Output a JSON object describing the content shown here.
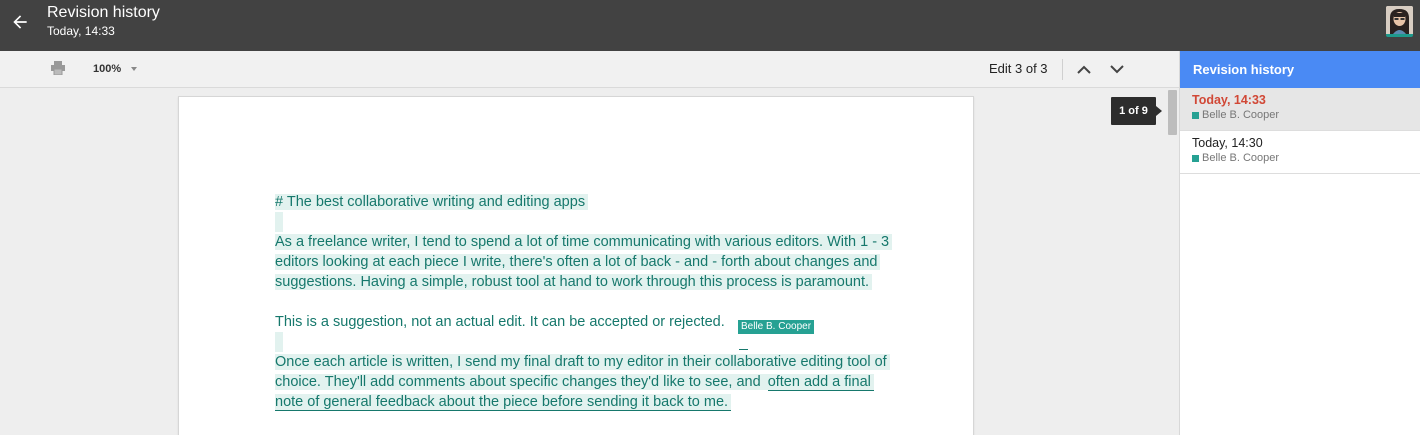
{
  "header": {
    "title": "Revision history",
    "subtitle": "Today, 14:33"
  },
  "toolbar": {
    "zoom": "100%",
    "edit_count": "Edit 3 of 3"
  },
  "document": {
    "heading": "# The best collaborative writing and editing apps",
    "para1": "As a freelance writer, I tend to spend a lot of time communicating with various editors. With 1 - 3 editors looking at each piece I write, there's often a lot of back - and - forth about changes and suggestions. Having a simple, robust tool at hand to work through this process is paramount.",
    "para2": "This is a suggestion, not an actual edit. It can be accepted or rejected.",
    "para3_a": "Once each article is written, I send my final draft to my editor in their collaborative editing tool of choice. They'll add comments about specific changes they'd like to see, and ",
    "para3_b": "often add a final note of general feedback about the piece before sending it back to me.",
    "cursor_label": "Belle B. Cooper"
  },
  "scroll": {
    "tooltip": "1 of 9"
  },
  "panel": {
    "title": "Revision history",
    "revisions": [
      {
        "time": "Today, 14:33",
        "author": "Belle B. Cooper",
        "active": true
      },
      {
        "time": "Today, 14:30",
        "author": "Belle B. Cooper",
        "active": false
      }
    ]
  },
  "colors": {
    "author_color": "#26a193",
    "active_time": "#d14836",
    "panel_header": "#4a8af4",
    "topbar": "#424242"
  }
}
